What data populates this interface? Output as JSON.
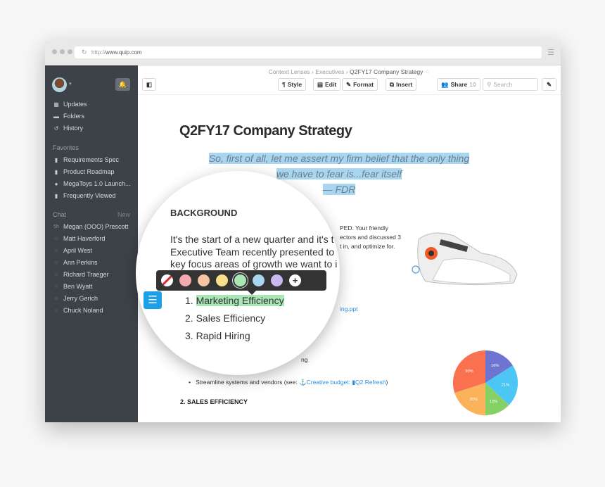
{
  "browser": {
    "url_prefix": "http://",
    "url_host": "www.quip.com"
  },
  "sidebar": {
    "nav": [
      {
        "label": "Updates",
        "icon": "calendar-icon"
      },
      {
        "label": "Folders",
        "icon": "folder-icon"
      },
      {
        "label": "History",
        "icon": "history-icon"
      }
    ],
    "favorites_heading": "Favorites",
    "favorites": [
      {
        "label": "Requirements Spec",
        "icon": "document-icon"
      },
      {
        "label": "Product Roadmap",
        "icon": "document-icon"
      },
      {
        "label": "MegaToys 1.0 Launch...",
        "icon": "chat-bubbles-icon"
      },
      {
        "label": "Frequently Viewed",
        "icon": "documents-icon"
      }
    ],
    "chat_heading": "Chat",
    "chat_new": "New",
    "chats": [
      {
        "prefix": "5h",
        "label": "Megan (OOO) Prescott"
      },
      {
        "prefix": "○",
        "label": "Matt Haverford"
      },
      {
        "prefix": "○",
        "label": "April West"
      },
      {
        "prefix": "○",
        "label": "Ann Perkins"
      },
      {
        "prefix": "○",
        "label": "Richard Traeger"
      },
      {
        "prefix": "○",
        "label": "Ben Wyatt"
      },
      {
        "prefix": "○",
        "label": "Jerry Gerich"
      },
      {
        "prefix": "○",
        "label": "Chuck Noland"
      }
    ]
  },
  "breadcrumb": {
    "a": "Context Lenses",
    "b": "Executives",
    "current": "Q2FY17 Company Strategy",
    "sep": "›"
  },
  "toolbar": {
    "style": "Style",
    "edit": "Edit",
    "format": "Format",
    "insert": "Insert",
    "share": "Share",
    "share_count": "10",
    "search_placeholder": "Search"
  },
  "doc": {
    "title": "Q2FY17 Company Strategy",
    "quote": [
      "So, first of all, let me assert my firm belief that the only thing",
      "we have to fear is...fear itself",
      "— FDR"
    ],
    "bg_fragments": [
      "PED. Your friendly",
      "ectors and discussed 3",
      "t in, and optimize for.",
      "ing.ppt",
      "ng"
    ],
    "bullet_text": "Streamline systems and vendors (see: ",
    "link1": "Creative budget:",
    "link2": "Q2 Refresh",
    "bullet_end": ")",
    "section2": "2. SALES EFFICIENCY"
  },
  "magnifier": {
    "heading": "BACKGROUND",
    "para": [
      "It's the start of a new quarter and it's t",
      "Executive Team recently presented to",
      "key focus  areas of growth we want to i"
    ],
    "list": [
      {
        "n": "1.",
        "label": "Marketing Efficiency"
      },
      {
        "n": "2.",
        "label": "Sales Efficiency"
      },
      {
        "n": "3.",
        "label": "Rapid Hiring"
      }
    ],
    "highlight_colors": [
      "#f4a9b0",
      "#f7c3a3",
      "#f8e08a",
      "#a8e6b4",
      "#a8d6f0",
      "#c8b8f0"
    ],
    "selected_color": "#a8e6b4"
  },
  "chart_data": {
    "type": "pie",
    "values": [
      16,
      21,
      13,
      20,
      30
    ],
    "labels": [
      "16%",
      "21%",
      "13%",
      "20%",
      "30%"
    ],
    "colors": [
      "#6e74cf",
      "#4cc7f5",
      "#86d166",
      "#fbb35b",
      "#fa7150"
    ]
  }
}
